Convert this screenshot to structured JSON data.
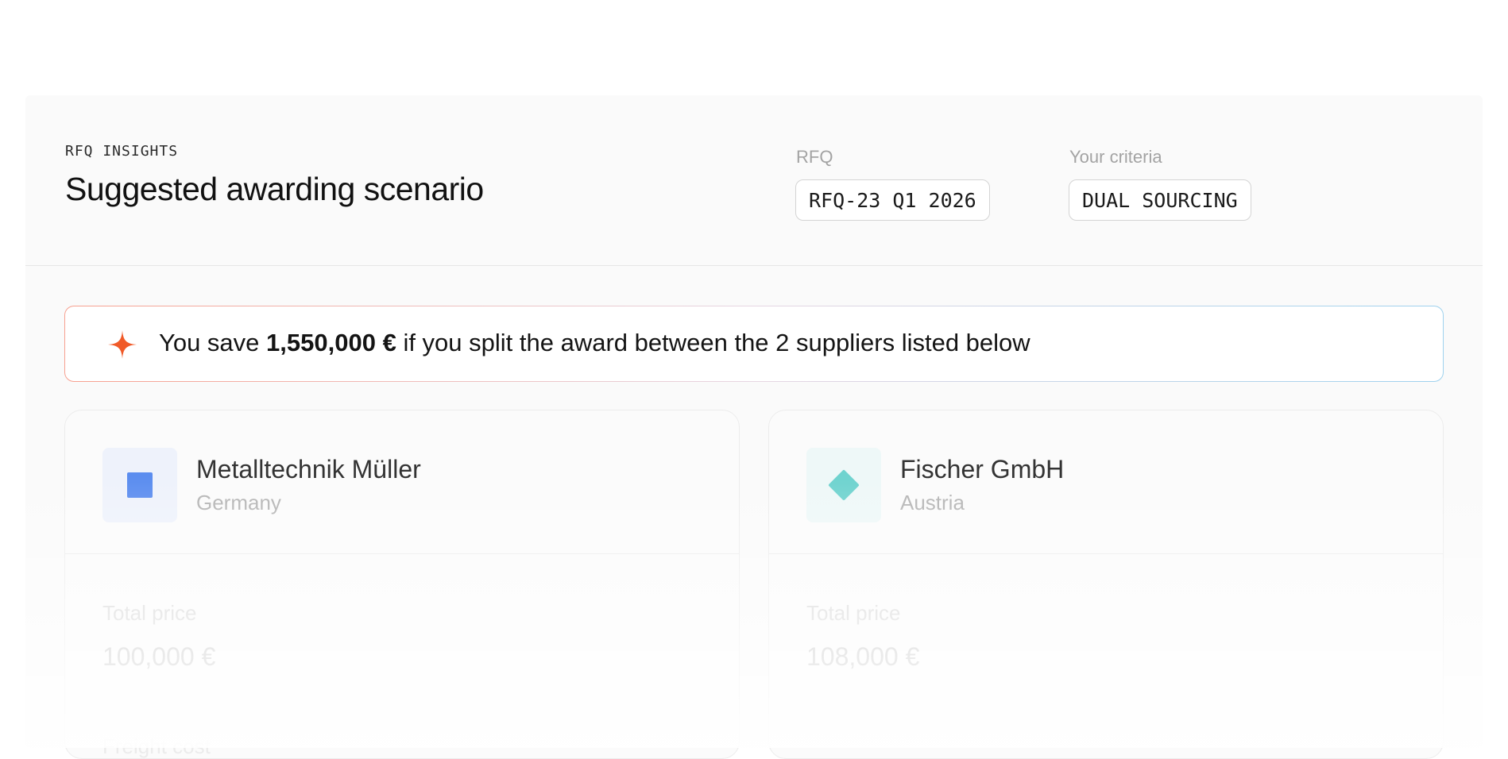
{
  "header": {
    "eyebrow": "RFQ INSIGHTS",
    "title": "Suggested awarding scenario",
    "rfq_label": "RFQ",
    "rfq_value": "RFQ-23 Q1 2026",
    "criteria_label": "Your criteria",
    "criteria_value": "DUAL SOURCING"
  },
  "savings": {
    "icon": "sparkle-icon",
    "prefix": "You save",
    "amount": "1,550,000 €",
    "suffix": "if you split the award between the 2 suppliers listed below"
  },
  "suppliers": [
    {
      "name": "Metalltechnik Müller",
      "country": "Germany",
      "logo_icon": "square-logo-icon",
      "logo_color": "#5b8def",
      "total_price_label": "Total price",
      "total_price": "100,000 €",
      "next_metric_label": "Freight cost"
    },
    {
      "name": "Fischer GmbH",
      "country": "Austria",
      "logo_icon": "diamond-logo-icon",
      "logo_color": "#6fd3cf",
      "total_price_label": "Total price",
      "total_price": "108,000 €"
    }
  ],
  "colors": {
    "accent_orange": "#f05a28",
    "banner_border_start": "#f7a08f",
    "banner_border_end": "#9ed2ee"
  }
}
